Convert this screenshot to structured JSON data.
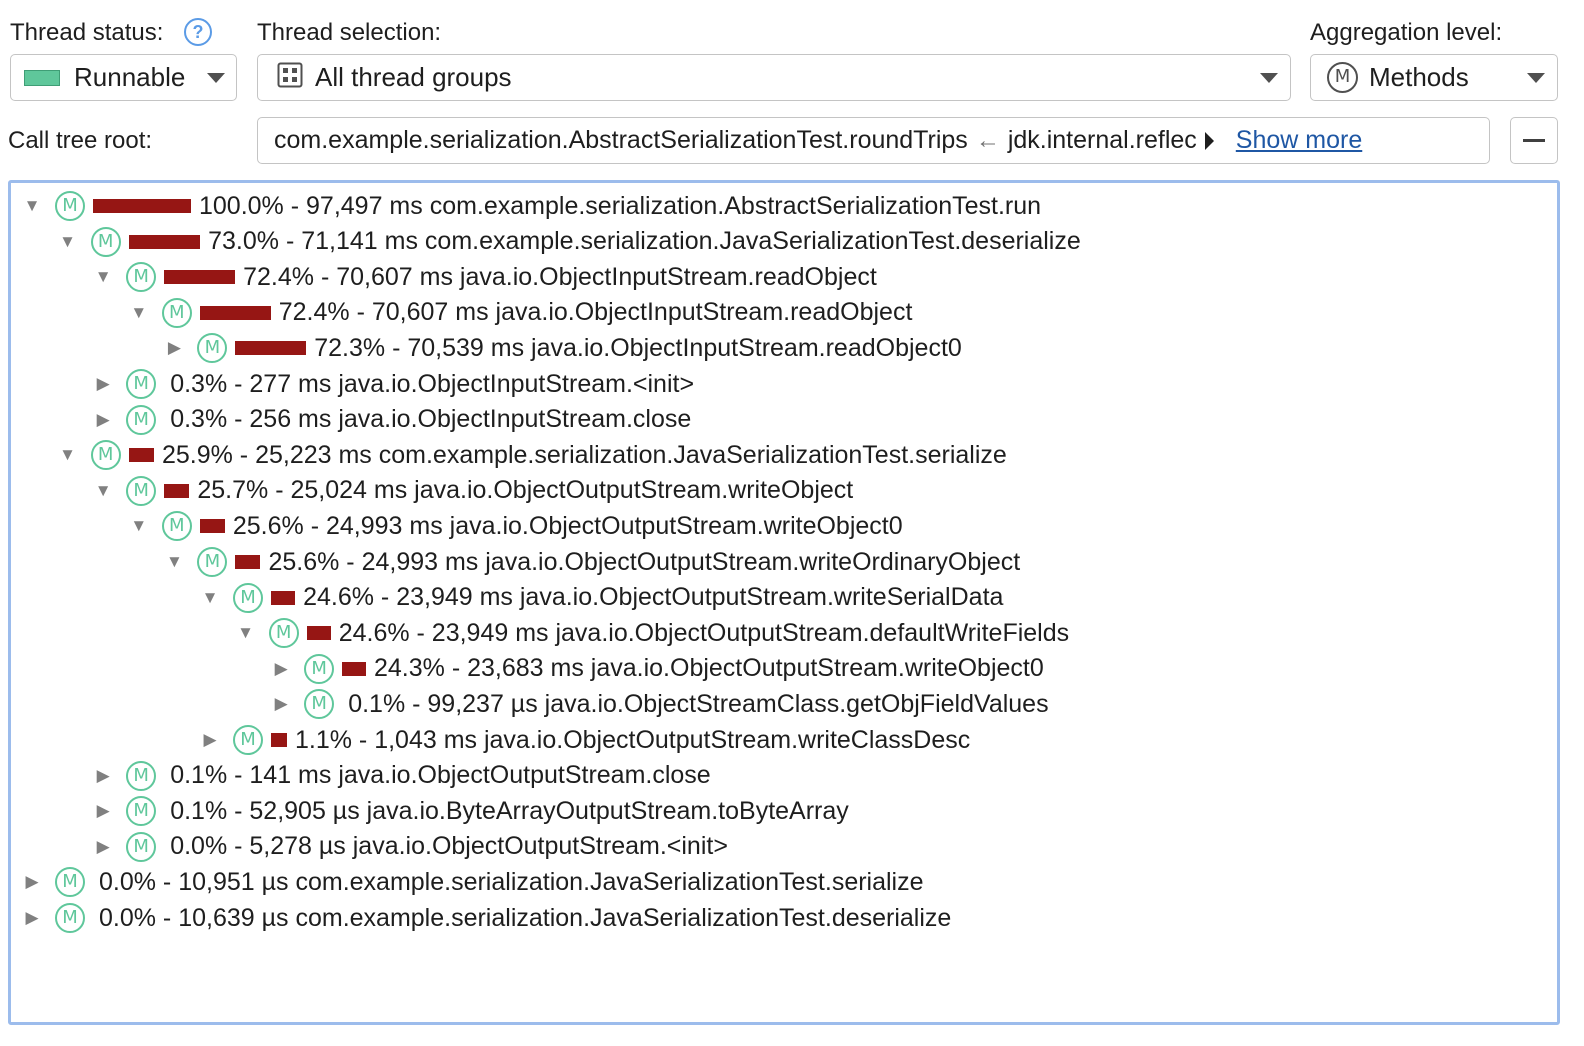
{
  "toolbar": {
    "thread_status_label": "Thread status:",
    "help_glyph": "?",
    "thread_status_value": "Runnable",
    "thread_status_color": "#5fc79b",
    "thread_selection_label": "Thread selection:",
    "thread_selection_value": "All thread groups",
    "aggregation_label": "Aggregation level:",
    "aggregation_value": "Methods",
    "method_badge": "M"
  },
  "call_tree_root": {
    "label": "Call tree root:",
    "path_start": "com.example.serialization.AbstractSerializationTest.roundTrips",
    "separator": "←",
    "path_next": "jdk.internal.reflec",
    "show_more": "Show more",
    "collapse_glyph": "—"
  },
  "colors": {
    "bar": "#961614",
    "method_icon": "#5fc79b",
    "tree_border": "#9cbcec",
    "link": "#1f57a4"
  },
  "tree": {
    "rows": [
      {
        "depth": 0,
        "expanded": true,
        "percent": 100.0,
        "text": "100.0% - 97,497 ms com.example.serialization.AbstractSerializationTest.run"
      },
      {
        "depth": 1,
        "expanded": true,
        "percent": 73.0,
        "text": "73.0% - 71,141 ms com.example.serialization.JavaSerializationTest.deserialize"
      },
      {
        "depth": 2,
        "expanded": true,
        "percent": 72.4,
        "text": "72.4% - 70,607 ms java.io.ObjectInputStream.readObject"
      },
      {
        "depth": 3,
        "expanded": true,
        "percent": 72.4,
        "text": "72.4% - 70,607 ms java.io.ObjectInputStream.readObject"
      },
      {
        "depth": 4,
        "expanded": false,
        "percent": 72.3,
        "text": "72.3% - 70,539 ms java.io.ObjectInputStream.readObject0"
      },
      {
        "depth": 2,
        "expanded": false,
        "percent": 0.3,
        "text": "0.3% - 277 ms java.io.ObjectInputStream.<init>"
      },
      {
        "depth": 2,
        "expanded": false,
        "percent": 0.3,
        "text": "0.3% - 256 ms java.io.ObjectInputStream.close"
      },
      {
        "depth": 1,
        "expanded": true,
        "percent": 25.9,
        "text": "25.9% - 25,223 ms com.example.serialization.JavaSerializationTest.serialize"
      },
      {
        "depth": 2,
        "expanded": true,
        "percent": 25.7,
        "text": "25.7% - 25,024 ms java.io.ObjectOutputStream.writeObject"
      },
      {
        "depth": 3,
        "expanded": true,
        "percent": 25.6,
        "text": "25.6% - 24,993 ms java.io.ObjectOutputStream.writeObject0"
      },
      {
        "depth": 4,
        "expanded": true,
        "percent": 25.6,
        "text": "25.6% - 24,993 ms java.io.ObjectOutputStream.writeOrdinaryObject"
      },
      {
        "depth": 5,
        "expanded": true,
        "percent": 24.6,
        "text": "24.6% - 23,949 ms java.io.ObjectOutputStream.writeSerialData"
      },
      {
        "depth": 6,
        "expanded": true,
        "percent": 24.6,
        "text": "24.6% - 23,949 ms java.io.ObjectOutputStream.defaultWriteFields"
      },
      {
        "depth": 7,
        "expanded": false,
        "percent": 24.3,
        "text": "24.3% - 23,683 ms java.io.ObjectOutputStream.writeObject0"
      },
      {
        "depth": 7,
        "expanded": false,
        "percent": 0.1,
        "text": "0.1% - 99,237 µs java.io.ObjectStreamClass.getObjFieldValues"
      },
      {
        "depth": 5,
        "expanded": false,
        "percent": 1.1,
        "text": "1.1% - 1,043 ms java.io.ObjectOutputStream.writeClassDesc"
      },
      {
        "depth": 2,
        "expanded": false,
        "percent": 0.1,
        "text": "0.1% - 141 ms java.io.ObjectOutputStream.close"
      },
      {
        "depth": 2,
        "expanded": false,
        "percent": 0.1,
        "text": "0.1% - 52,905 µs java.io.ByteArrayOutputStream.toByteArray"
      },
      {
        "depth": 2,
        "expanded": false,
        "percent": 0.0,
        "text": "0.0% - 5,278 µs java.io.ObjectOutputStream.<init>"
      },
      {
        "depth": 0,
        "expanded": false,
        "percent": 0.0,
        "text": "0.0% - 10,951 µs com.example.serialization.JavaSerializationTest.serialize"
      },
      {
        "depth": 0,
        "expanded": false,
        "percent": 0.0,
        "text": "0.0% - 10,639 µs com.example.serialization.JavaSerializationTest.deserialize"
      }
    ]
  }
}
